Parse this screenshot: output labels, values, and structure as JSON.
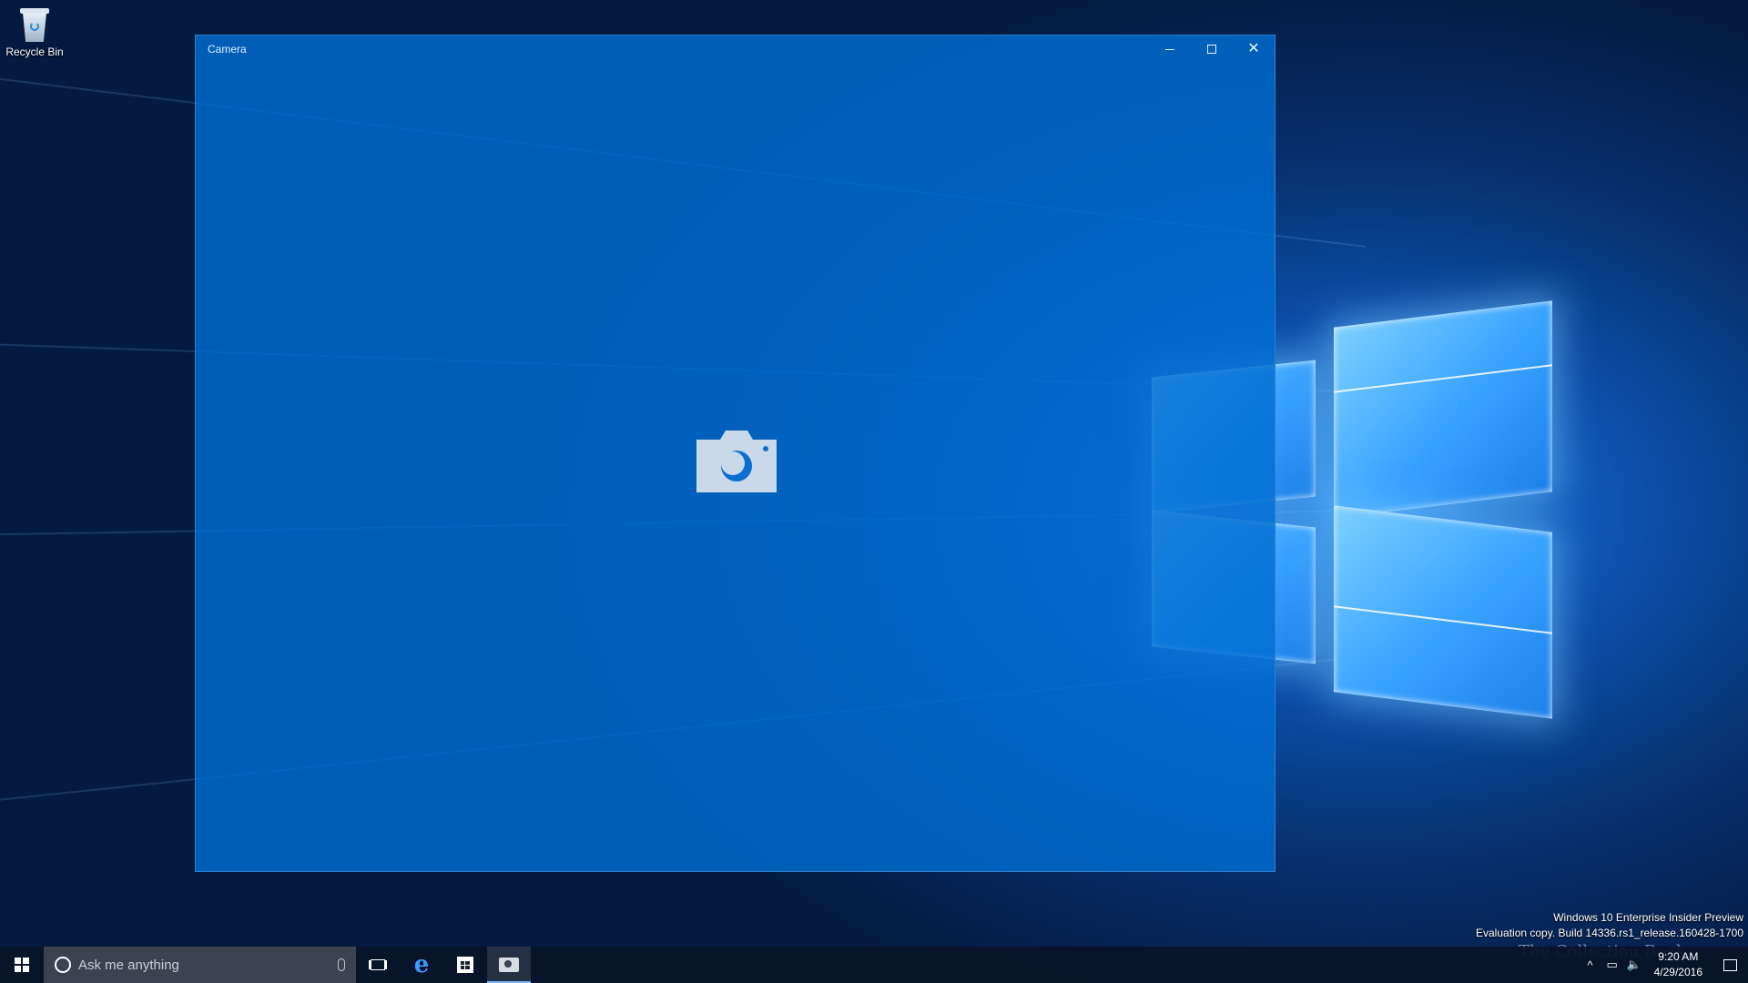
{
  "desktop": {
    "icons": [
      {
        "label": "Recycle Bin",
        "icon": "recycle-bin-icon"
      }
    ]
  },
  "window": {
    "title": "Camera",
    "minimize": "minimize",
    "maximize": "maximize",
    "close": "close",
    "placeholder_icon": "camera-icon",
    "accent": "#0a6fd1"
  },
  "taskbar": {
    "search_placeholder": "Ask me anything",
    "pinned": [
      "task-view-icon",
      "edge-icon",
      "store-icon",
      "camera-icon"
    ],
    "clock_time": "9:20 AM",
    "clock_date": "4/29/2016",
    "tray_chevron": "^"
  },
  "watermark": {
    "line1": "Windows 10 Enterprise Insider Preview",
    "line2": "Evaluation copy. Build 14336.rs1_release.160428-1700",
    "overlay": "The Collection Book"
  }
}
